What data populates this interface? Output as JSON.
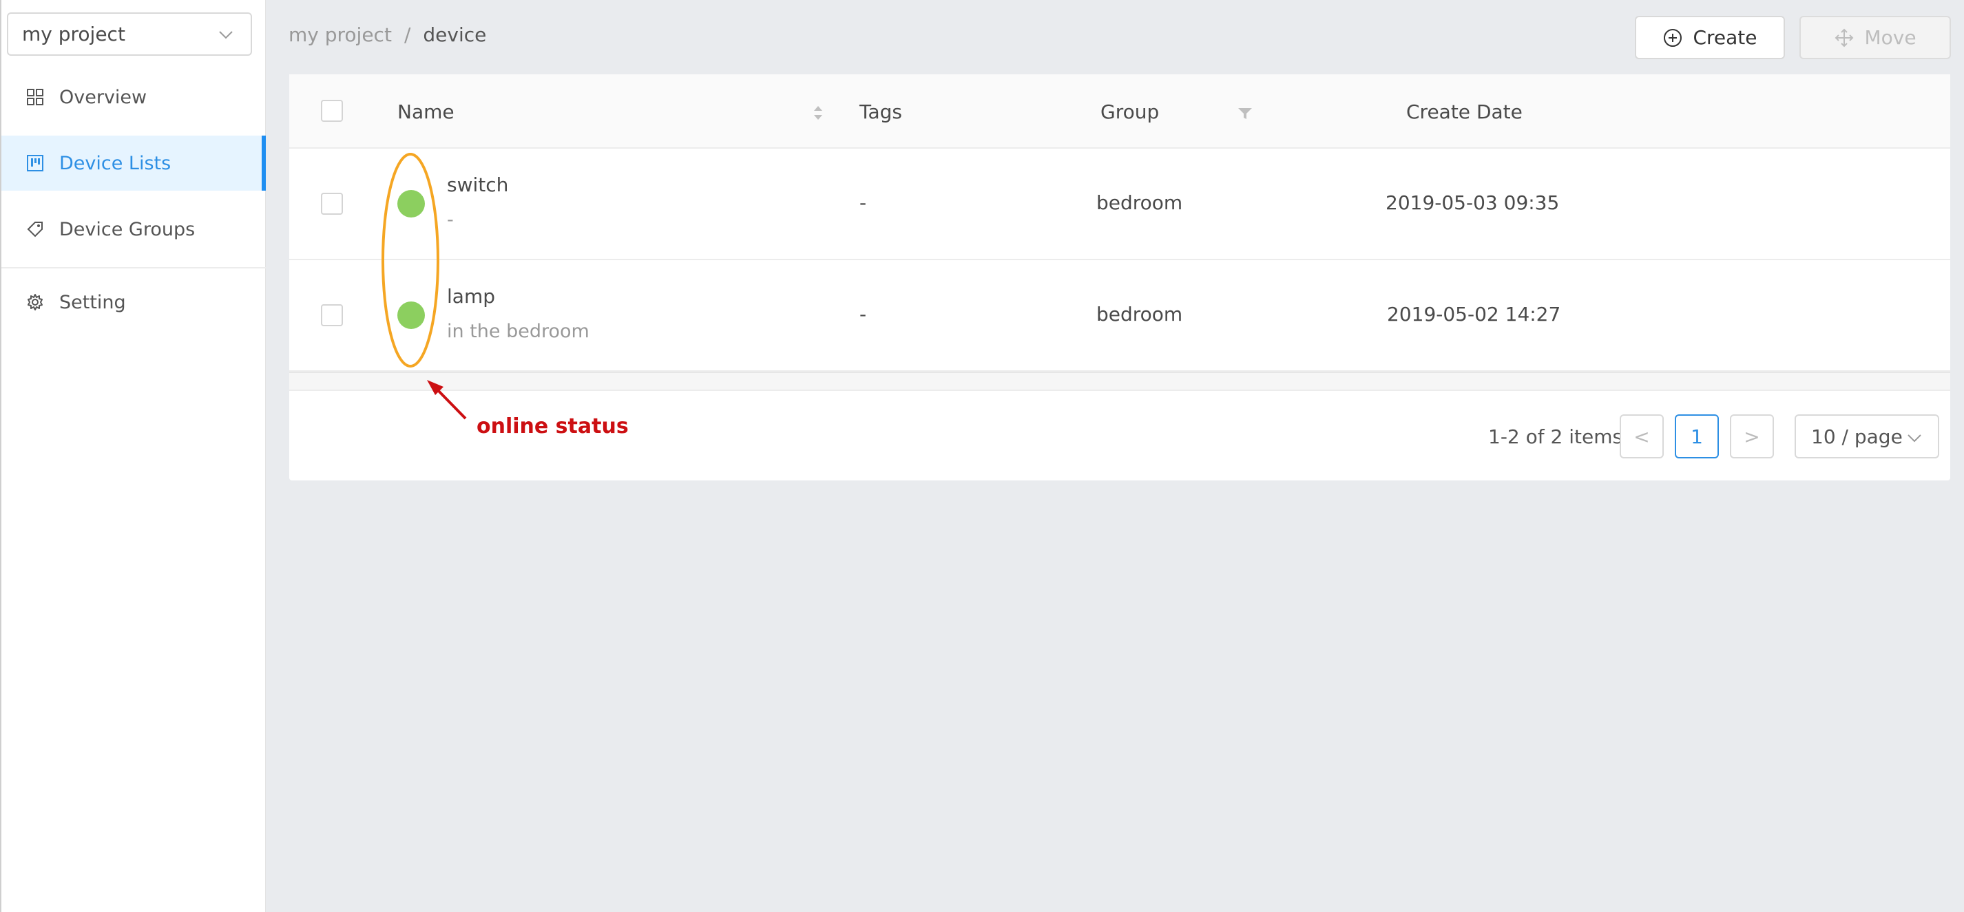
{
  "sidebar": {
    "project_select": "my project",
    "items": [
      {
        "label": "Overview",
        "icon": "grid-icon"
      },
      {
        "label": "Device Lists",
        "icon": "board-icon",
        "active": true
      },
      {
        "label": "Device Groups",
        "icon": "tag-icon"
      },
      {
        "label": "Setting",
        "icon": "gear-icon"
      }
    ]
  },
  "header": {
    "breadcrumb": [
      "my project",
      "device"
    ],
    "separator": "/",
    "create_label": "Create",
    "move_label": "Move"
  },
  "table": {
    "columns": {
      "name": "Name",
      "tags": "Tags",
      "group": "Group",
      "create_date": "Create Date"
    },
    "rows": [
      {
        "name": "switch",
        "description": "-",
        "tags": "-",
        "group": "bedroom",
        "create_date": "2019-05-03 09:35",
        "online": true
      },
      {
        "name": "lamp",
        "description": "in the bedroom",
        "tags": "-",
        "group": "bedroom",
        "create_date": "2019-05-02 14:27",
        "online": true
      }
    ]
  },
  "pagination": {
    "total_text": "1-2 of 2 items",
    "prev": "<",
    "current_page": "1",
    "next": ">",
    "page_size": "10 / page"
  },
  "annotation": {
    "label": "online status",
    "color": "#cc0f12",
    "outline_color": "#f5a623"
  },
  "colors": {
    "accent": "#1f8ef1",
    "online": "#8ccf5f"
  }
}
